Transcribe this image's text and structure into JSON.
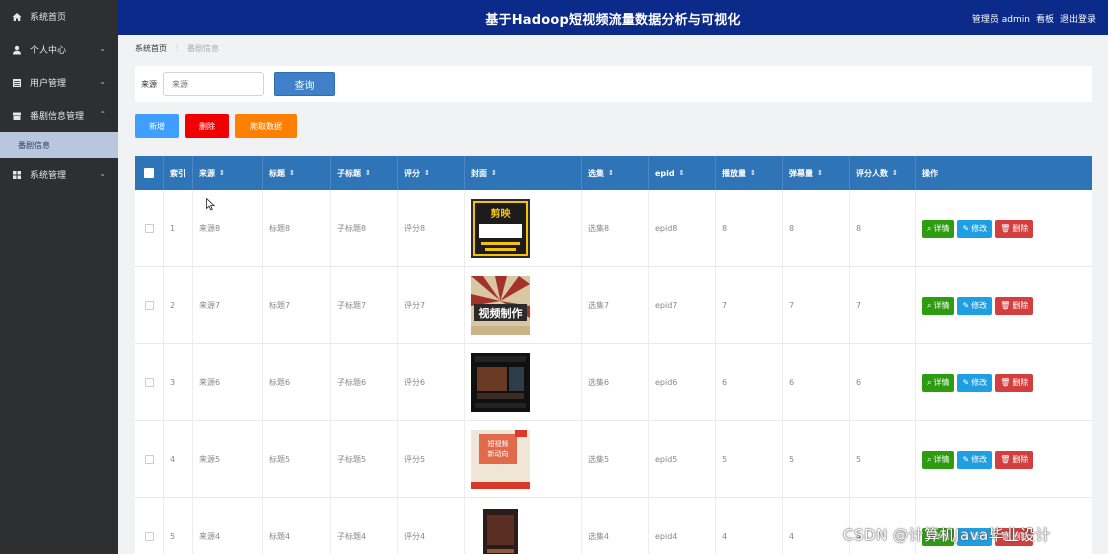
{
  "sidebar": {
    "items": [
      {
        "label": "系统首页",
        "icon": "home-icon"
      },
      {
        "label": "个人中心",
        "icon": "user-icon"
      },
      {
        "label": "用户管理",
        "icon": "list-icon"
      },
      {
        "label": "番剧信息管理",
        "icon": "archive-icon"
      },
      {
        "label": "系统管理",
        "icon": "grid-icon"
      }
    ],
    "sub_item": "番剧信息"
  },
  "header": {
    "title": "基于Hadoop短视频流量数据分析与可视化",
    "role_user": "管理员 admin",
    "board": "看板",
    "logout": "退出登录"
  },
  "breadcrumb": {
    "home": "系统首页",
    "current": "番剧信息"
  },
  "search": {
    "label": "来源",
    "placeholder": "来源",
    "button": "查询"
  },
  "actions": {
    "add": "新增",
    "delete": "删除",
    "crawl": "爬取数据"
  },
  "colors": {
    "add": "#409eff",
    "delete": "#f00000",
    "crawl": "#ff8000",
    "detail": "#2e9c10",
    "edit": "#1f9fe3",
    "remove": "#d33f3f",
    "header": "#2f74b6",
    "topbar": "#0b2a8a"
  },
  "table": {
    "columns": [
      "索引",
      "来源",
      "标题",
      "子标题",
      "评分",
      "封面",
      "选集",
      "epid",
      "播放量",
      "弹幕量",
      "评分人数",
      "操作"
    ],
    "rows": [
      {
        "idx": "1",
        "source": "来源8",
        "title": "标题8",
        "subtitle": "子标题8",
        "score": "评分8",
        "episode": "选集8",
        "epid": "epid8",
        "plays": "8",
        "danmaku": "8",
        "raters": "8"
      },
      {
        "idx": "2",
        "source": "来源7",
        "title": "标题7",
        "subtitle": "子标题7",
        "score": "评分7",
        "episode": "选集7",
        "epid": "epid7",
        "plays": "7",
        "danmaku": "7",
        "raters": "7"
      },
      {
        "idx": "3",
        "source": "来源6",
        "title": "标题6",
        "subtitle": "子标题6",
        "score": "评分6",
        "episode": "选集6",
        "epid": "epid6",
        "plays": "6",
        "danmaku": "6",
        "raters": "6"
      },
      {
        "idx": "4",
        "source": "来源5",
        "title": "标题5",
        "subtitle": "子标题5",
        "score": "评分5",
        "episode": "选集5",
        "epid": "epid5",
        "plays": "5",
        "danmaku": "5",
        "raters": "5"
      },
      {
        "idx": "5",
        "source": "来源4",
        "title": "标题4",
        "subtitle": "子标题4",
        "score": "评分4",
        "episode": "选集4",
        "epid": "epid4",
        "plays": "4",
        "danmaku": "4",
        "raters": "4"
      }
    ],
    "row_buttons": {
      "detail": "详情",
      "edit": "修改",
      "remove": "删除"
    }
  },
  "watermark": "CSDN @计算机Java毕业设计"
}
